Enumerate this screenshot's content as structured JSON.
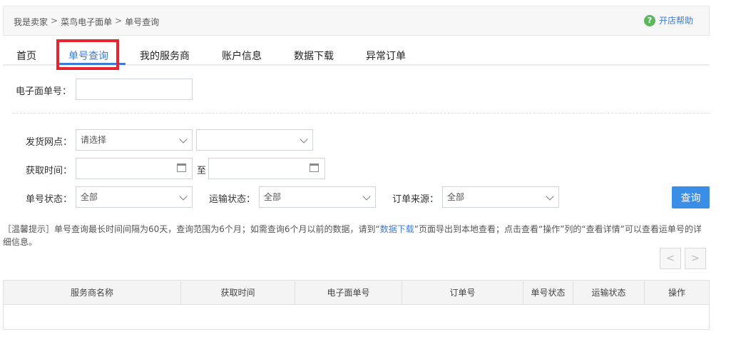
{
  "breadcrumb": {
    "items": [
      "我是卖家",
      "菜鸟电子面单",
      "单号查询"
    ],
    "separator": ">"
  },
  "help": {
    "icon": "question-circle-icon",
    "label": "开店帮助"
  },
  "tabs": [
    {
      "label": "首页",
      "active": false
    },
    {
      "label": "单号查询",
      "active": true
    },
    {
      "label": "我的服务商",
      "active": false
    },
    {
      "label": "账户信息",
      "active": false
    },
    {
      "label": "数据下载",
      "active": false
    },
    {
      "label": "异常订单",
      "active": false
    }
  ],
  "form": {
    "waybill_label": "电子面单号：",
    "waybill_value": "",
    "branch_label": "发货网点：",
    "branch_select_value": "请选择",
    "branch_select2_value": "",
    "time_label": "获取时间：",
    "time_from": "",
    "time_to_label": "至",
    "time_to": "",
    "status_label": "单号状态：",
    "status_value": "全部",
    "transport_label": "运输状态：",
    "transport_value": "全部",
    "source_label": "订单来源：",
    "source_value": "全部",
    "query_button": "查询"
  },
  "tip": {
    "text1": "［温馨提示］单号查询最长时间间隔为60天，查询范围为6个月；如需查询6个月以前的数据，请到“",
    "link": "数据下载",
    "text2": "”页面导出到本地查看；点击查看“操作”列的“查看详情”可以查看运单号的详细信息。"
  },
  "pager": {
    "prev": "<",
    "next": ">"
  },
  "table": {
    "columns": [
      "服务商名称",
      "获取时间",
      "电子面单号",
      "订单号",
      "单号状态",
      "运输状态",
      "操作"
    ]
  },
  "colors": {
    "accent": "#3c7bd6",
    "button": "#3a8ee6",
    "highlight": "#e8252f"
  }
}
